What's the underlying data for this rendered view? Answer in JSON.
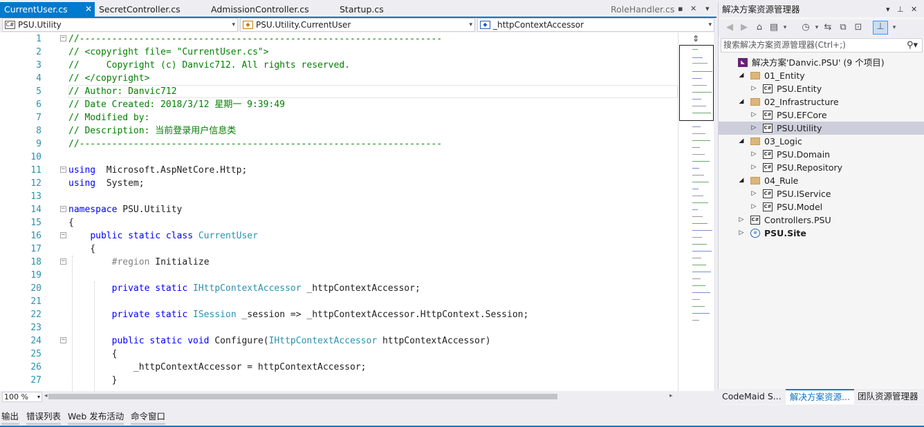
{
  "tabs": [
    {
      "label": "CurrentUser.cs",
      "active": true,
      "pinned": false
    },
    {
      "label": "SecretController.cs"
    },
    {
      "label": "AdmissionController.cs"
    },
    {
      "label": "Startup.cs"
    },
    {
      "label": "RoleHandler.cs"
    }
  ],
  "tabs_right": {
    "pin_icon": "pin-icon",
    "dropdown_icon": "chevron-down-icon"
  },
  "navbar": {
    "project": "PSU.Utility",
    "class": "PSU.Utility.CurrentUser",
    "member": "_httpContextAccessor",
    "project_icon": "C#"
  },
  "code_lines": [
    {
      "n": "1",
      "parts": [
        [
          "cm",
          "//-------------------------------------------------------------------"
        ]
      ]
    },
    {
      "n": "2",
      "parts": [
        [
          "cm",
          "// <copyright file= \"CurrentUser.cs\">"
        ]
      ]
    },
    {
      "n": "3",
      "parts": [
        [
          "cm",
          "//     Copyright (c) Danvic712. All rights reserved."
        ]
      ]
    },
    {
      "n": "4",
      "parts": [
        [
          "cm",
          "// </copyright>"
        ]
      ]
    },
    {
      "n": "5",
      "parts": [
        [
          "cm",
          "// Author: Danvic712"
        ]
      ]
    },
    {
      "n": "6",
      "parts": [
        [
          "cm",
          "// Date Created: 2018/3/12 星期一 9:39:49"
        ]
      ]
    },
    {
      "n": "7",
      "parts": [
        [
          "cm",
          "// Modified by:"
        ]
      ]
    },
    {
      "n": "8",
      "parts": [
        [
          "cm",
          "// Description: 当前登录用户信息类"
        ]
      ]
    },
    {
      "n": "9",
      "parts": [
        [
          "cm",
          "//-------------------------------------------------------------------"
        ]
      ]
    },
    {
      "n": "10",
      "parts": []
    },
    {
      "n": "11",
      "parts": [
        [
          "kw",
          "using"
        ],
        [
          "",
          "  Microsoft.AspNetCore.Http;"
        ]
      ]
    },
    {
      "n": "12",
      "parts": [
        [
          "kw",
          "using"
        ],
        [
          "",
          "  System;"
        ]
      ]
    },
    {
      "n": "13",
      "parts": []
    },
    {
      "n": "14",
      "parts": [
        [
          "kw",
          "namespace"
        ],
        [
          "",
          " PSU.Utility"
        ]
      ]
    },
    {
      "n": "15",
      "parts": [
        [
          "",
          "{"
        ]
      ]
    },
    {
      "n": "16",
      "parts": [
        [
          "",
          "    "
        ],
        [
          "kw",
          "public static class"
        ],
        [
          "",
          " "
        ],
        [
          "ty",
          "CurrentUser"
        ]
      ]
    },
    {
      "n": "17",
      "parts": [
        [
          "",
          "    {"
        ]
      ]
    },
    {
      "n": "18",
      "parts": [
        [
          "",
          "        "
        ],
        [
          "pp",
          "#region"
        ],
        [
          "",
          " Initialize"
        ]
      ]
    },
    {
      "n": "19",
      "parts": []
    },
    {
      "n": "20",
      "parts": [
        [
          "",
          "        "
        ],
        [
          "kw",
          "private static"
        ],
        [
          "",
          " "
        ],
        [
          "ty",
          "IHttpContextAccessor"
        ],
        [
          "",
          " _httpContextAccessor;"
        ]
      ]
    },
    {
      "n": "21",
      "parts": []
    },
    {
      "n": "22",
      "parts": [
        [
          "",
          "        "
        ],
        [
          "kw",
          "private static"
        ],
        [
          "",
          " "
        ],
        [
          "ty",
          "ISession"
        ],
        [
          "",
          " _session => _httpContextAccessor.HttpContext.Session;"
        ]
      ]
    },
    {
      "n": "23",
      "parts": []
    },
    {
      "n": "24",
      "parts": [
        [
          "",
          "        "
        ],
        [
          "kw",
          "public static void"
        ],
        [
          "",
          " Configure("
        ],
        [
          "ty",
          "IHttpContextAccessor"
        ],
        [
          "",
          " httpContextAccessor)"
        ]
      ]
    },
    {
      "n": "25",
      "parts": [
        [
          "",
          "        {"
        ]
      ]
    },
    {
      "n": "26",
      "parts": [
        [
          "",
          "            _httpContextAccessor = httpContextAccessor;"
        ]
      ]
    },
    {
      "n": "27",
      "parts": [
        [
          "",
          "        }"
        ]
      ]
    }
  ],
  "zoom": "100 %",
  "bottom_tabs": [
    "输出",
    "错误列表",
    "Web 发布活动",
    "命令窗口"
  ],
  "solution_explorer": {
    "title": "解决方案资源管理器",
    "search_placeholder": "搜索解决方案资源管理器(Ctrl+;)",
    "tree": [
      {
        "label": "解决方案'Danvic.PSU' (9 个项目)",
        "depth": 0,
        "icon": "sln",
        "exp": ""
      },
      {
        "label": "01_Entity",
        "depth": 1,
        "icon": "folder",
        "exp": "◢"
      },
      {
        "label": "PSU.Entity",
        "depth": 2,
        "icon": "csproj",
        "exp": "▷"
      },
      {
        "label": "02_Infrastructure",
        "depth": 1,
        "icon": "folder",
        "exp": "◢"
      },
      {
        "label": "PSU.EFCore",
        "depth": 2,
        "icon": "csproj",
        "exp": "▷"
      },
      {
        "label": "PSU.Utility",
        "depth": 2,
        "icon": "csproj",
        "exp": "▷",
        "selected": true
      },
      {
        "label": "03_Logic",
        "depth": 1,
        "icon": "folder",
        "exp": "◢"
      },
      {
        "label": "PSU.Domain",
        "depth": 2,
        "icon": "csproj",
        "exp": "▷"
      },
      {
        "label": "PSU.Repository",
        "depth": 2,
        "icon": "csproj",
        "exp": "▷"
      },
      {
        "label": "04_Rule",
        "depth": 1,
        "icon": "folder",
        "exp": "◢"
      },
      {
        "label": "PSU.IService",
        "depth": 2,
        "icon": "csproj",
        "exp": "▷"
      },
      {
        "label": "PSU.Model",
        "depth": 2,
        "icon": "csproj",
        "exp": "▷"
      },
      {
        "label": "Controllers.PSU",
        "depth": 1,
        "icon": "csproj",
        "exp": "▷"
      },
      {
        "label": "PSU.Site",
        "depth": 1,
        "icon": "web",
        "exp": "▷",
        "bold": true
      }
    ],
    "tabs": [
      "CodeMaid S...",
      "解决方案资源...",
      "团队资源管理器"
    ]
  },
  "colors": {
    "accent": "#007ACC",
    "comment": "#008000",
    "keyword": "#0000FF",
    "type": "#2B91AF"
  }
}
